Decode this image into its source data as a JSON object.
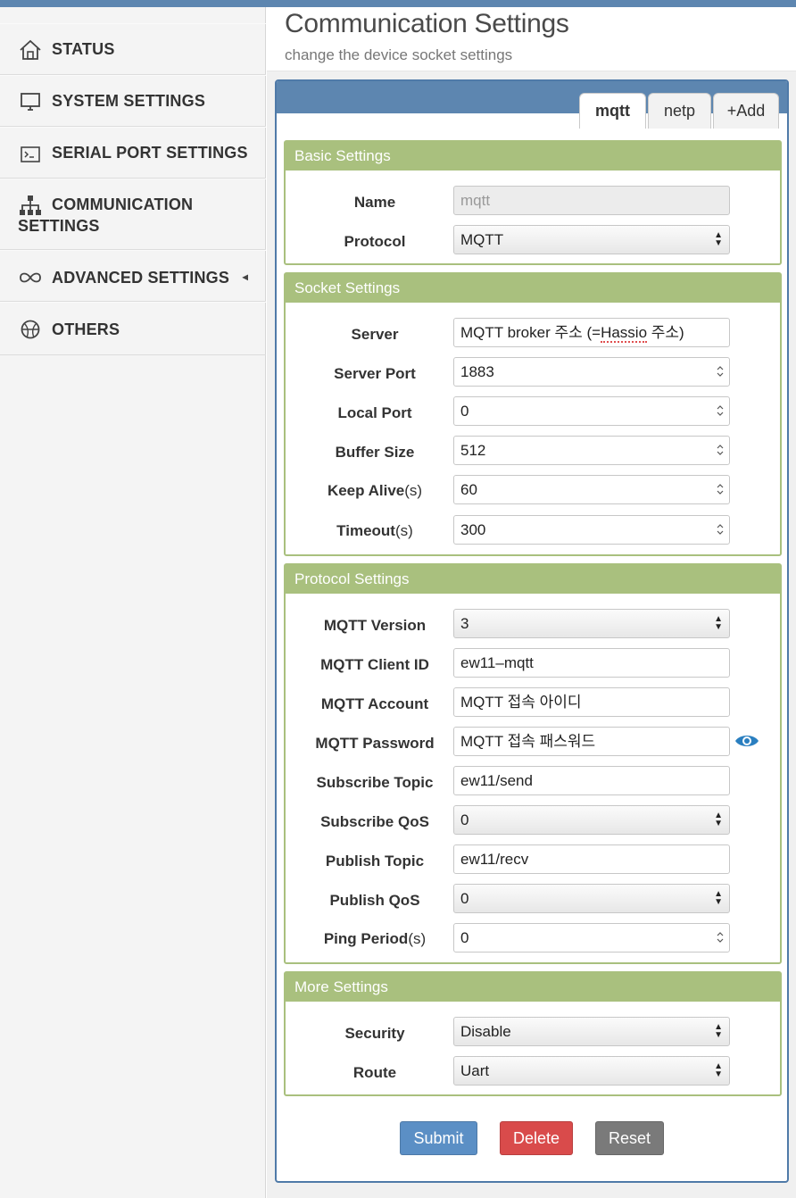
{
  "sidebar": {
    "items": [
      {
        "label": "STATUS",
        "icon": "home-icon"
      },
      {
        "label": "SYSTEM SETTINGS",
        "icon": "monitor-icon"
      },
      {
        "label": "SERIAL PORT SETTINGS",
        "icon": "terminal-icon"
      },
      {
        "label": "COMMUNICATION",
        "label2": "SETTINGS",
        "icon": "sitemap-icon"
      },
      {
        "label": "ADVANCED SETTINGS",
        "icon": "infinity-icon",
        "caret": "◂"
      },
      {
        "label": "OTHERS",
        "icon": "basketball-icon"
      }
    ]
  },
  "header": {
    "title": "Communication Settings",
    "subtitle": "change the device socket settings"
  },
  "tabs": [
    {
      "label": "mqtt",
      "active": true
    },
    {
      "label": "netp",
      "active": false
    },
    {
      "label": "+Add",
      "active": false
    }
  ],
  "basic": {
    "title": "Basic Settings",
    "name_label": "Name",
    "name_value": "mqtt",
    "protocol_label": "Protocol",
    "protocol_value": "MQTT"
  },
  "socket": {
    "title": "Socket Settings",
    "server_label": "Server",
    "server_value_prefix": "MQTT broker 주소 (=",
    "server_value_flagged": "Hassio",
    "server_value_suffix": " 주소)",
    "server_port_label": "Server Port",
    "server_port_value": "1883",
    "local_port_label": "Local Port",
    "local_port_value": "0",
    "buffer_size_label": "Buffer Size",
    "buffer_size_value": "512",
    "keep_alive_label": "Keep Alive",
    "keep_alive_unit": "(s)",
    "keep_alive_value": "60",
    "timeout_label": "Timeout",
    "timeout_unit": "(s)",
    "timeout_value": "300"
  },
  "protocol": {
    "title": "Protocol Settings",
    "version_label": "MQTT Version",
    "version_value": "3",
    "client_id_label": "MQTT Client ID",
    "client_id_value": "ew11–mqtt",
    "account_label": "MQTT Account",
    "account_value": "MQTT 접속 아이디",
    "password_label": "MQTT Password",
    "password_value": "MQTT 접속 패스워드",
    "sub_topic_label": "Subscribe Topic",
    "sub_topic_value": "ew11/send",
    "sub_qos_label": "Subscribe QoS",
    "sub_qos_value": "0",
    "pub_topic_label": "Publish Topic",
    "pub_topic_value": "ew11/recv",
    "pub_qos_label": "Publish QoS",
    "pub_qos_value": "0",
    "ping_label": "Ping Period",
    "ping_unit": "(s)",
    "ping_value": "0"
  },
  "more": {
    "title": "More Settings",
    "security_label": "Security",
    "security_value": "Disable",
    "route_label": "Route",
    "route_value": "Uart"
  },
  "buttons": {
    "submit": "Submit",
    "delete": "Delete",
    "reset": "Reset"
  },
  "colors": {
    "accent_blue": "#5d86b0",
    "section_green": "#a9c07e",
    "submit": "#5b8fc5",
    "delete": "#d94b4b",
    "reset": "#7a7a7a",
    "eye": "#2a7fc0"
  }
}
